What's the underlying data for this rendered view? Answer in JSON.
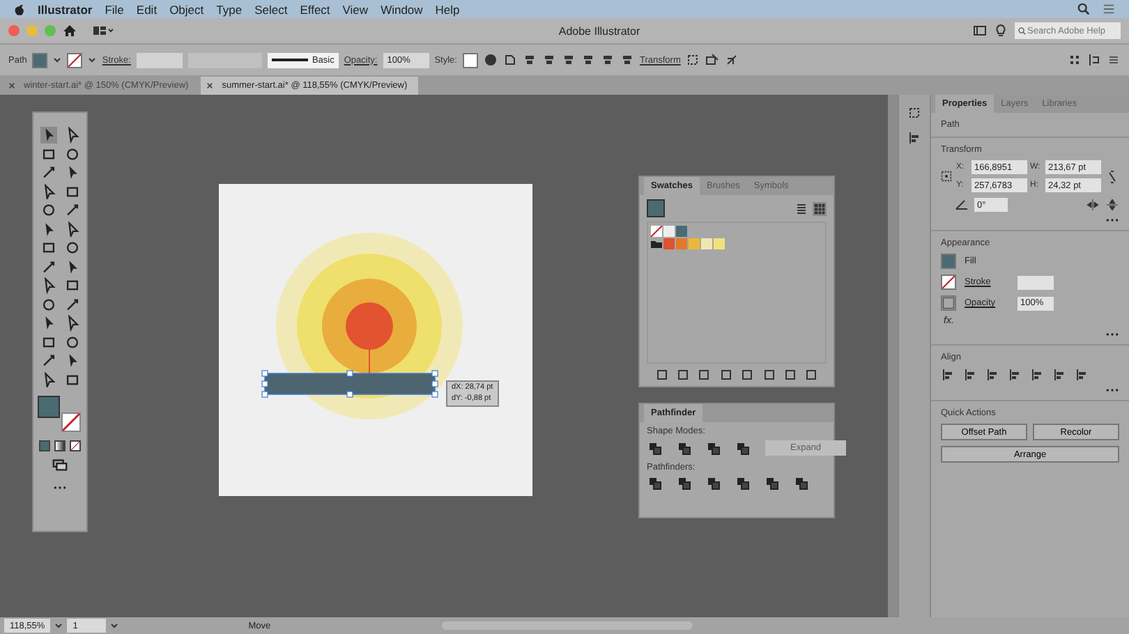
{
  "menu_bar": {
    "app": "Illustrator",
    "items": [
      "File",
      "Edit",
      "Object",
      "Type",
      "Select",
      "Effect",
      "View",
      "Window",
      "Help"
    ]
  },
  "title_bar": {
    "title": "Adobe Illustrator",
    "search": {
      "placeholder": "Search Adobe Help"
    }
  },
  "control_bar": {
    "selection": "Path",
    "stroke_label": "Stroke:",
    "stroke_style": "Basic",
    "opacity_label": "Opacity:",
    "opacity": "100%",
    "style_label": "Style:",
    "transform": "Transform"
  },
  "doc_tabs": [
    {
      "label": "winter-start.ai* @ 150% (CMYK/Preview)",
      "selected": false
    },
    {
      "label": "summer-start.ai* @ 118,55% (CMYK/Preview)",
      "selected": true
    }
  ],
  "canvas": {
    "tooltip": [
      "dX: 28,74 pt",
      "dY: -0,88 pt"
    ]
  },
  "swatches_panel": {
    "tabs": [
      {
        "label": "Swatches",
        "selected": true
      },
      {
        "label": "Brushes",
        "selected": false
      },
      {
        "label": "Symbols",
        "selected": false
      }
    ],
    "swatches": [
      {
        "color": "#e0532f"
      },
      {
        "color": "#e27a2a"
      },
      {
        "color": "#ebb83a"
      },
      {
        "color": "#efe7b0"
      },
      {
        "color": "#efe27a"
      }
    ]
  },
  "pathfinder_panel": {
    "title": "Pathfinder",
    "shape_modes_label": "Shape Modes:",
    "expand": {
      "label": "Expand",
      "disabled": true
    },
    "pathfinders_label": "Pathfinders:"
  },
  "properties": {
    "tabs": [
      {
        "label": "Properties",
        "selected": true
      },
      {
        "label": "Layers",
        "selected": false
      },
      {
        "label": "Libraries",
        "selected": false
      }
    ],
    "object_type": "Path",
    "transform": {
      "title": "Transform",
      "fields": [
        {
          "label": "X:",
          "value": "166,8951"
        },
        {
          "label": "W:",
          "value": "213,67 pt"
        },
        {
          "label": "Y:",
          "value": "257,6783"
        },
        {
          "label": "H:",
          "value": "24,32 pt"
        }
      ],
      "angle": "0°"
    },
    "appearance": {
      "title": "Appearance",
      "fill": "Fill",
      "stroke": "Stroke",
      "opacity_label": "Opacity",
      "opacity": "100%",
      "fx": "fx."
    },
    "align": {
      "title": "Align"
    },
    "quick_actions": {
      "title": "Quick Actions",
      "buttons": [
        "Offset Path",
        "Recolor",
        "Arrange"
      ]
    }
  },
  "status_bar": {
    "zoom": "118,55%",
    "artboard": "1",
    "tool": "Move"
  }
}
